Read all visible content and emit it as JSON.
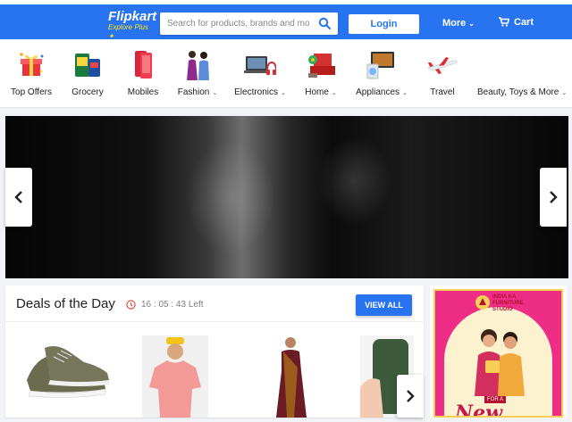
{
  "header": {
    "logo_main": "Flipkart",
    "logo_sub": "Explore Plus",
    "search_placeholder": "Search for products, brands and more",
    "login_label": "Login",
    "more_label": "More",
    "cart_label": "Cart",
    "accent": "#2874f0"
  },
  "categories": [
    {
      "label": "Top Offers",
      "icon": "gift-icon",
      "dropdown": false
    },
    {
      "label": "Grocery",
      "icon": "grocery-icon",
      "dropdown": false
    },
    {
      "label": "Mobiles",
      "icon": "mobile-phone-icon",
      "dropdown": false
    },
    {
      "label": "Fashion",
      "icon": "fashion-people-icon",
      "dropdown": true
    },
    {
      "label": "Electronics",
      "icon": "laptop-headphones-icon",
      "dropdown": true
    },
    {
      "label": "Home",
      "icon": "home-furnishing-icon",
      "dropdown": true
    },
    {
      "label": "Appliances",
      "icon": "tv-appliance-icon",
      "dropdown": true
    },
    {
      "label": "Travel",
      "icon": "airplane-icon",
      "dropdown": false
    },
    {
      "label": "Beauty, Toys & More",
      "icon": "toy-icon",
      "dropdown": true
    }
  ],
  "deals": {
    "title": "Deals of the Day",
    "timer": "16 : 05 : 43 Left",
    "view_all_label": "VIEW ALL",
    "items": [
      {
        "name": "sports-shoe",
        "icon": "shoe-image"
      },
      {
        "name": "pink-t-shirt",
        "icon": "tshirt-image"
      },
      {
        "name": "saree",
        "icon": "saree-image"
      },
      {
        "name": "phone-cover",
        "icon": "phone-cover-image"
      }
    ]
  },
  "ad": {
    "brand_line1": "INDIA KA",
    "brand_line2": "FURNITURE",
    "brand_line3": "STUDIO",
    "for_text": "FOR A",
    "new_text": "New"
  }
}
